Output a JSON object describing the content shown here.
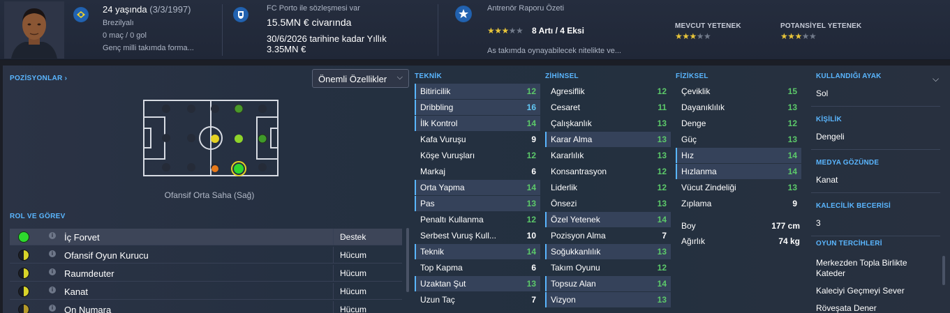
{
  "header": {
    "age_line": "24 yaşında",
    "birth_date": "(3/3/1997)",
    "nationality": "Brezilyalı",
    "apps_goals": "0 maç / 0 gol",
    "youth_note": "Genç milli takımda forma...",
    "contract_title": "FC Porto ile sözleşmesi var",
    "value": "15.5MN € civarında",
    "contract_line1": "30/6/2026 tarihine kadar Yıllık",
    "contract_line2": "3.35MN €",
    "report_title": "Antrenör Raporu Özeti",
    "report_summary": "8 Artı / 4 Eksi",
    "report_stars": 3,
    "report_note": "As takımda oynayabilecek nitelikte ve...",
    "current_ability_label": "MEVCUT YETENEK",
    "current_ability_stars": 3,
    "potential_ability_label": "POTANSİYEL YETENEK",
    "potential_ability_stars": 3,
    "icons": {
      "nation": "flag-badge-icon",
      "club": "club-crest-icon",
      "report": "star-badge-icon"
    }
  },
  "positions": {
    "title": "POZİSYONLAR",
    "chevron_icon": "chevron-right-icon",
    "filter_value": "Önemli Özellikler",
    "position_caption": "Ofansif Orta Saha (Sağ)",
    "colors": {
      "natural": "#2ed92e",
      "accomplished": "#8fd42a",
      "competent": "#e5d222",
      "unconvincing": "#e87a1a",
      "unfamiliar": "#3f7a2a"
    }
  },
  "roles": {
    "title": "ROL VE GÖREV",
    "items": [
      {
        "name": "İç Forvet",
        "duty": "Destek",
        "suitability": "natural"
      },
      {
        "name": "Ofansif Oyun Kurucu",
        "duty": "Hücum",
        "suitability": "half"
      },
      {
        "name": "Raumdeuter",
        "duty": "Hücum",
        "suitability": "half"
      },
      {
        "name": "Kanat",
        "duty": "Hücum",
        "suitability": "half"
      },
      {
        "name": "On Numara",
        "duty": "Hücum",
        "suitability": "half-dark"
      }
    ]
  },
  "attributes": {
    "technical_title": "TEKNİK",
    "mental_title": "ZİHİNSEL",
    "physical_title": "FİZİKSEL",
    "technical": [
      {
        "name": "Bitiricilik",
        "value": "12",
        "hl": true
      },
      {
        "name": "Dribbling",
        "value": "16",
        "hl": true
      },
      {
        "name": "İlk Kontrol",
        "value": "14",
        "hl": true
      },
      {
        "name": "Kafa Vuruşu",
        "value": "9",
        "hl": false
      },
      {
        "name": "Köşe Vuruşları",
        "value": "12",
        "hl": false
      },
      {
        "name": "Markaj",
        "value": "6",
        "hl": false
      },
      {
        "name": "Orta Yapma",
        "value": "14",
        "hl": true
      },
      {
        "name": "Pas",
        "value": "13",
        "hl": true
      },
      {
        "name": "Penaltı Kullanma",
        "value": "12",
        "hl": false
      },
      {
        "name": "Serbest Vuruş Kull...",
        "value": "10",
        "hl": false
      },
      {
        "name": "Teknik",
        "value": "14",
        "hl": true
      },
      {
        "name": "Top Kapma",
        "value": "6",
        "hl": false
      },
      {
        "name": "Uzaktan Şut",
        "value": "13",
        "hl": true
      },
      {
        "name": "Uzun Taç",
        "value": "7",
        "hl": false
      }
    ],
    "mental": [
      {
        "name": "Agresiflik",
        "value": "12",
        "hl": false
      },
      {
        "name": "Cesaret",
        "value": "11",
        "hl": false
      },
      {
        "name": "Çalışkanlık",
        "value": "13",
        "hl": false
      },
      {
        "name": "Karar Alma",
        "value": "13",
        "hl": true
      },
      {
        "name": "Kararlılık",
        "value": "13",
        "hl": false
      },
      {
        "name": "Konsantrasyon",
        "value": "12",
        "hl": false
      },
      {
        "name": "Liderlik",
        "value": "12",
        "hl": false
      },
      {
        "name": "Önsezi",
        "value": "13",
        "hl": false
      },
      {
        "name": "Özel Yetenek",
        "value": "14",
        "hl": true
      },
      {
        "name": "Pozisyon Alma",
        "value": "7",
        "hl": false
      },
      {
        "name": "Soğukkanlılık",
        "value": "13",
        "hl": true
      },
      {
        "name": "Takım Oyunu",
        "value": "12",
        "hl": false
      },
      {
        "name": "Topsuz Alan",
        "value": "14",
        "hl": true
      },
      {
        "name": "Vizyon",
        "value": "13",
        "hl": true
      }
    ],
    "physical": [
      {
        "name": "Çeviklik",
        "value": "15",
        "hl": false
      },
      {
        "name": "Dayanıklılık",
        "value": "13",
        "hl": false
      },
      {
        "name": "Denge",
        "value": "12",
        "hl": false
      },
      {
        "name": "Güç",
        "value": "13",
        "hl": false
      },
      {
        "name": "Hız",
        "value": "14",
        "hl": true
      },
      {
        "name": "Hızlanma",
        "value": "14",
        "hl": true
      },
      {
        "name": "Vücut Zindeliği",
        "value": "13",
        "hl": false
      },
      {
        "name": "Zıplama",
        "value": "9",
        "hl": false
      }
    ],
    "height_label": "Boy",
    "height_value": "177 cm",
    "weight_label": "Ağırlık",
    "weight_value": "74 kg"
  },
  "profile": {
    "foot_label": "KULLANDIĞI AYAK",
    "foot_value": "Sol",
    "personality_label": "KİŞİLİK",
    "personality_value": "Dengeli",
    "media_label": "MEDYA GÖZÜNDE",
    "media_value": "Kanat",
    "gk_label": "KALECİLİK BECERİSİ",
    "gk_value": "3",
    "traits_label": "OYUN TERCİHLERİ",
    "traits": [
      "Merkezden Topla Birlikte",
      "Kateder",
      "Kaleciyi Geçmeyi Sever",
      "Röveşata Dener"
    ]
  }
}
